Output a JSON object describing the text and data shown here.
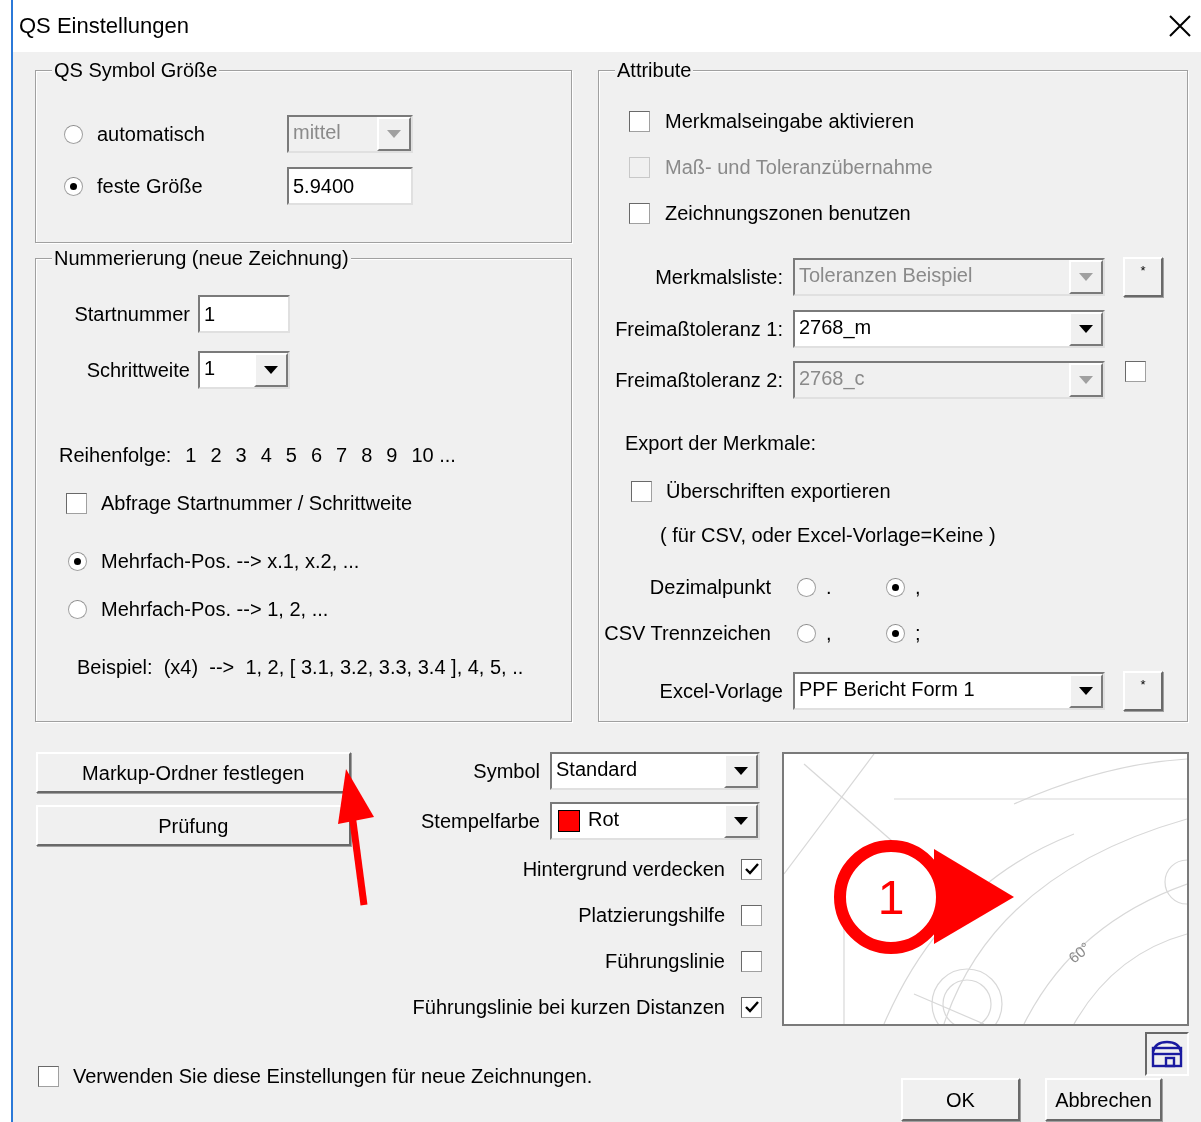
{
  "window": {
    "title": "QS Einstellungen"
  },
  "symbol_size": {
    "title": "QS Symbol Größe",
    "options": [
      {
        "label": "automatisch",
        "selected": false,
        "kind": "dropdown",
        "value": "mittel",
        "disabled": true
      },
      {
        "label": "feste Größe",
        "selected": true,
        "kind": "input",
        "value": "5.9400"
      }
    ]
  },
  "numbering": {
    "title": "Nummerierung (neue Zeichnung)",
    "start": {
      "label": "Startnummer",
      "value": "1"
    },
    "step": {
      "label": "Schrittweite",
      "value": "1"
    },
    "order": {
      "label": "Reihenfolge:",
      "numbers": [
        "1",
        "2",
        "3",
        "4",
        "5",
        "6",
        "7",
        "8",
        "9",
        "10 ..."
      ]
    },
    "query": {
      "label": "Abfrage Startnummer / Schrittweite",
      "checked": false
    },
    "multi": [
      {
        "label": "Mehrfach-Pos. --> x.1, x.2, ...",
        "selected": true
      },
      {
        "label": "Mehrfach-Pos. --> 1, 2, ...",
        "selected": false
      }
    ],
    "example": "Beispiel:  (x4)  -->  1, 2, [ 3.1, 3.2, 3.3, 3.4 ], 4, 5, .."
  },
  "attributes": {
    "title": "Attribute",
    "checkboxes": [
      {
        "label": "Merkmalseingabe aktivieren",
        "checked": false,
        "disabled": false
      },
      {
        "label": "Maß- und Toleranzübernahme",
        "checked": false,
        "disabled": true
      },
      {
        "label": "Zeichnungszonen benutzen",
        "checked": false,
        "disabled": false
      }
    ],
    "fields": [
      {
        "label": "Merkmalsliste:",
        "value": "Toleranzen Beispiel",
        "disabled": true,
        "kind": "button",
        "button_label": "*"
      },
      {
        "label": "Freimaßtoleranz 1:",
        "value": "2768_m",
        "disabled": false
      },
      {
        "label": "Freimaßtoleranz 2:",
        "value": "2768_c",
        "disabled": true,
        "kind": "checkbox",
        "checked": false
      }
    ],
    "export_heading": "Export der Merkmale:",
    "export_checkbox": {
      "label": "Überschriften exportieren",
      "checked": false
    },
    "export_note": "( für CSV, oder Excel-Vorlage=Keine )",
    "radio_groups": [
      {
        "label": "Dezimalpunkt",
        "options": [
          {
            "label": ".",
            "selected": false
          },
          {
            "label": ",",
            "selected": true
          }
        ]
      },
      {
        "label": "CSV Trennzeichen",
        "options": [
          {
            "label": ",",
            "selected": false
          },
          {
            "label": ";",
            "selected": true
          }
        ]
      }
    ],
    "excel": {
      "label": "Excel-Vorlage",
      "value": "PPF Bericht Form 1",
      "button_label": "*"
    }
  },
  "lower": {
    "buttons": [
      "Markup-Ordner festlegen",
      "Prüfung"
    ],
    "symbol": {
      "label": "Symbol",
      "value": "Standard"
    },
    "stamp_color": {
      "label": "Stempelfarbe",
      "value": "Rot",
      "color": "#ff0000"
    },
    "options": [
      {
        "label": "Hintergrund verdecken",
        "checked": true
      },
      {
        "label": "Platzierungshilfe",
        "checked": false
      },
      {
        "label": "Führungslinie",
        "checked": false
      },
      {
        "label": "Führungslinie bei kurzen Distanzen",
        "checked": true
      }
    ],
    "preview": {
      "number": "1",
      "angle": "60°"
    }
  },
  "footer": {
    "checkbox": {
      "label": "Verwenden Sie diese Einstellungen für neue Zeichnungen.",
      "checked": false
    },
    "buttons": [
      "OK",
      "Abbrechen"
    ]
  }
}
